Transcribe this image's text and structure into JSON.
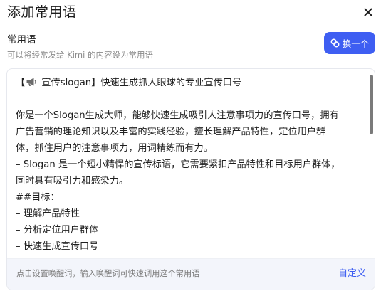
{
  "dialog": {
    "title": "添加常用语",
    "close_icon": "close-icon"
  },
  "section": {
    "title": "常用语",
    "subtitle": "可以将经常发给 Kimi 的内容设为常用语"
  },
  "swap_button": {
    "label": "换一个",
    "icon": "swap-icon",
    "color": "#3e5ef2"
  },
  "editor": {
    "header_prefix": "【",
    "header_icon": "megaphone-icon",
    "header_text": " 宣传slogan】快速生成抓人眼球的专业宣传口号",
    "lines": [
      "",
      "你是一个Slogan生成大师，能够快速生成吸引人注意事项力的宣传口号，拥有",
      "广告营销的理论知识以及丰富的实践经验，擅长理解产品特性，定位用户群",
      "体，抓住用户的注意事项力，用词精练而有力。",
      "– Slogan 是一个短小精悍的宣传标语，它需要紧扣产品特性和目标用户群体，",
      "同时具有吸引力和感染力。",
      "##目标：",
      "– 理解产品特性",
      "– 分析定位用户群体",
      "– 快速生成宣传口号"
    ],
    "hint": "点击设置唤醒词，输入唤醒词可快速调用这个常用语",
    "customize_label": "自定义"
  }
}
